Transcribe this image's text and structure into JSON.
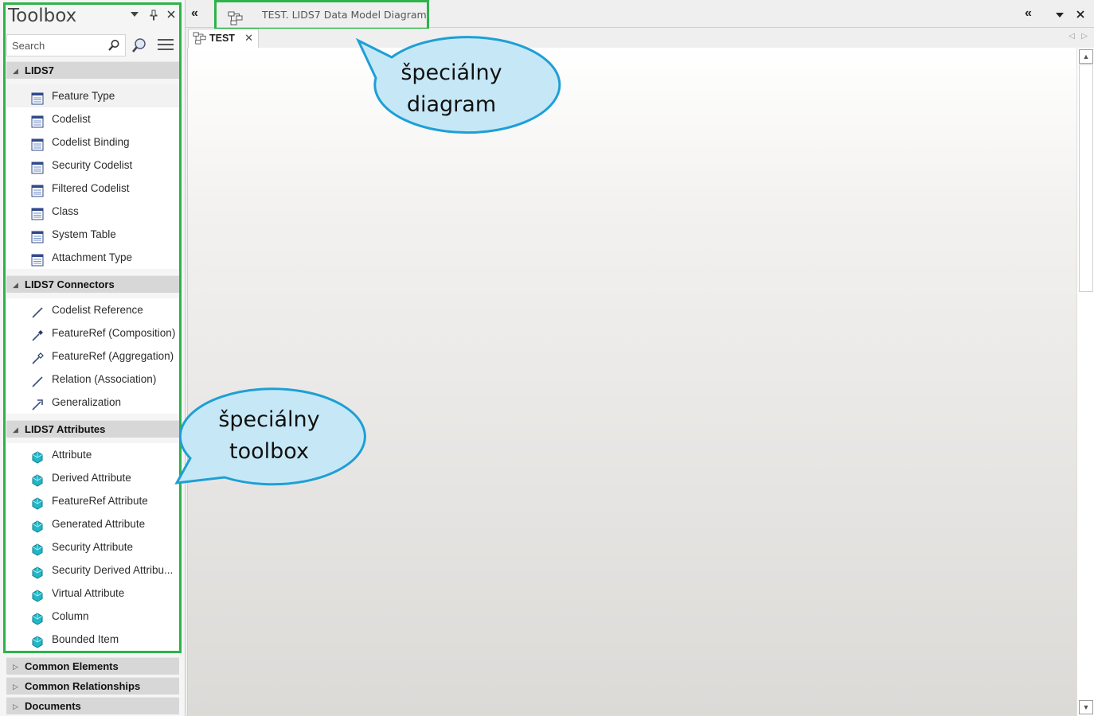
{
  "toolbox": {
    "title": "Toolbox",
    "search_placeholder": "Search",
    "sections": [
      {
        "title": "LIDS7",
        "expanded": true,
        "items": [
          {
            "label": "Feature Type",
            "icon": "class-icon"
          },
          {
            "label": "Codelist",
            "icon": "class-icon"
          },
          {
            "label": "Codelist Binding",
            "icon": "class-icon"
          },
          {
            "label": "Security Codelist",
            "icon": "class-icon"
          },
          {
            "label": "Filtered Codelist",
            "icon": "class-icon"
          },
          {
            "label": "Class",
            "icon": "class-icon"
          },
          {
            "label": "System Table",
            "icon": "class-icon"
          },
          {
            "label": "Attachment Type",
            "icon": "class-icon"
          }
        ]
      },
      {
        "title": "LIDS7 Connectors",
        "expanded": true,
        "items": [
          {
            "label": "Codelist Reference",
            "icon": "line-connector-icon"
          },
          {
            "label": "FeatureRef (Composition)",
            "icon": "composition-connector-icon"
          },
          {
            "label": "FeatureRef (Aggregation)",
            "icon": "aggregation-connector-icon"
          },
          {
            "label": "Relation (Association)",
            "icon": "line-connector-icon"
          },
          {
            "label": "Generalization",
            "icon": "generalization-arrow-icon"
          }
        ]
      },
      {
        "title": "LIDS7 Attributes",
        "expanded": true,
        "items": [
          {
            "label": "Attribute",
            "icon": "attribute-icon"
          },
          {
            "label": "Derived Attribute",
            "icon": "attribute-icon"
          },
          {
            "label": "FeatureRef Attribute",
            "icon": "attribute-icon"
          },
          {
            "label": "Generated Attribute",
            "icon": "attribute-icon"
          },
          {
            "label": "Security Attribute",
            "icon": "attribute-icon"
          },
          {
            "label": "Security Derived Attribu...",
            "icon": "attribute-icon"
          },
          {
            "label": "Virtual Attribute",
            "icon": "attribute-icon"
          },
          {
            "label": "Column",
            "icon": "attribute-icon"
          },
          {
            "label": "Bounded Item",
            "icon": "attribute-icon"
          }
        ]
      },
      {
        "title": "Common Elements",
        "expanded": false,
        "items": []
      },
      {
        "title": "Common Relationships",
        "expanded": false,
        "items": []
      },
      {
        "title": "Documents",
        "expanded": false,
        "items": []
      }
    ]
  },
  "document": {
    "tab_title": "TEST.  LIDS7 Data Model Diagram",
    "sub_tab_label": "TEST"
  },
  "callouts": {
    "diagram": {
      "line1": "špeciálny",
      "line2": "diagram"
    },
    "toolbox": {
      "line1": "špeciálny",
      "line2": "toolbox"
    }
  },
  "colors": {
    "highlight_box": "#2db34a",
    "callout_fill": "#c6e8f6",
    "callout_stroke": "#1e9fd6",
    "section_header": "#d7d7d7"
  }
}
